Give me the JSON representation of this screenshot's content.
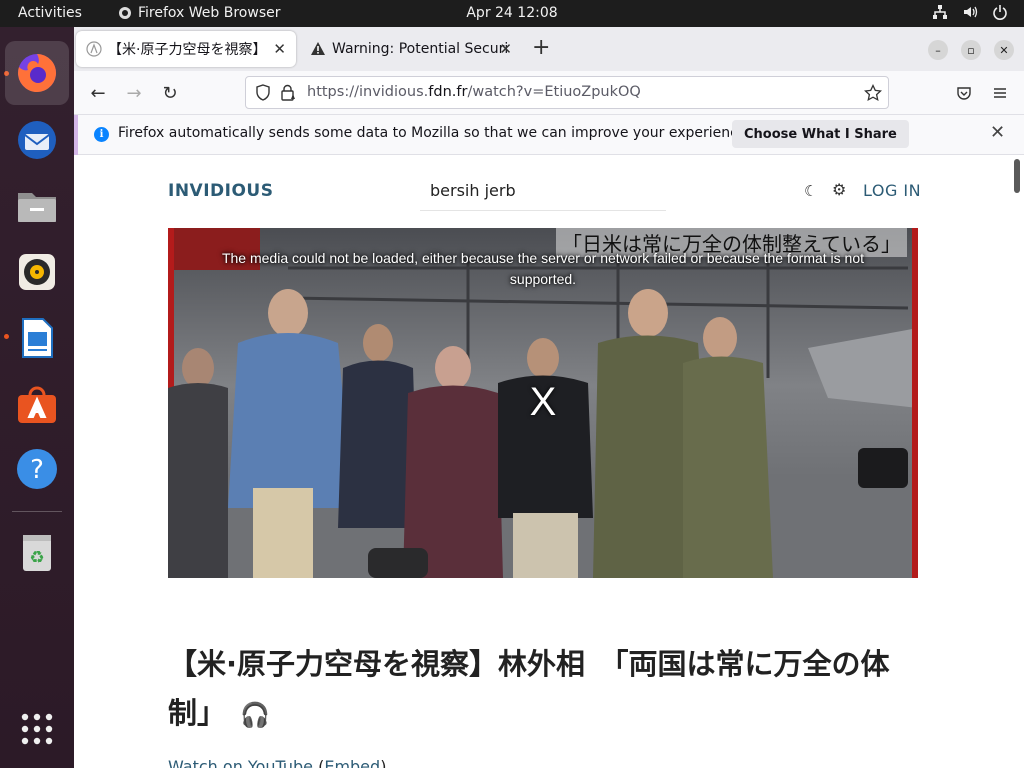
{
  "topbar": {
    "activities": "Activities",
    "app_name": "Firefox Web Browser",
    "clock": "Apr 24  12:08"
  },
  "dock": {
    "items": [
      "firefox-icon",
      "thunderbird-icon",
      "files-icon",
      "rhythmbox-icon",
      "writer-icon",
      "software-icon",
      "help-icon",
      "trash-icon",
      "app-grid-icon"
    ]
  },
  "browser": {
    "tabs": [
      {
        "title": "【米·原子力空母を視察】",
        "active": true
      },
      {
        "title": "Warning: Potential Securi",
        "active": false
      }
    ],
    "url_prefix": "https://invidious.",
    "url_host": "fdn.fr",
    "url_path": "/watch?v=EtiuoZpukOQ",
    "notification": {
      "message": "Firefox automatically sends some data to Mozilla so that we can improve your experience.",
      "button": "Choose What I Share"
    }
  },
  "page": {
    "logo": "INVIDIOUS",
    "search_value": "bersih jerb",
    "login": "LOG IN",
    "player": {
      "error": "The media could not be loaded, either because the server or network failed or because the format is not supported.",
      "close": "X",
      "burned_caption": "「日米は常に万全の体制整えている」"
    },
    "title": "【米·原子力空母を視察】林外相　「両国は常に万全の体制」",
    "watch_on_youtube": "Watch on YouTube",
    "embed": "Embed",
    "colors": {
      "link": "#2c5b75",
      "dock_bg": "#2f1c2a",
      "accent": "#e95420"
    }
  }
}
